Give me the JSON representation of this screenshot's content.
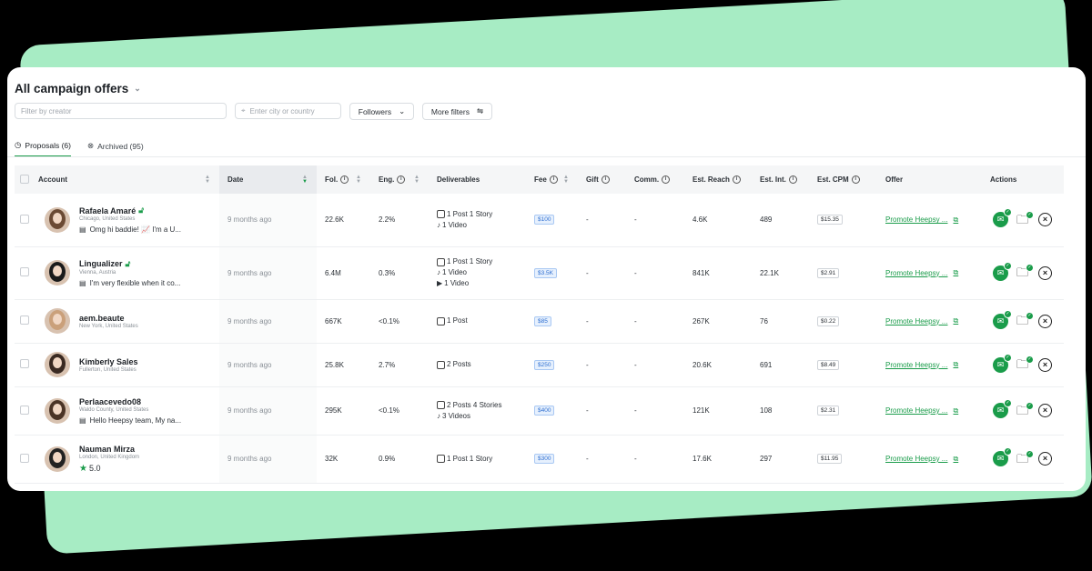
{
  "page": {
    "title": "All campaign offers",
    "filter_creator_placeholder": "Filter by creator",
    "filter_city_placeholder": "Enter city or country",
    "followers_label": "Followers",
    "more_filters_label": "More filters",
    "tabs": [
      {
        "label": "Proposals (6)"
      },
      {
        "label": "Archived (95)"
      }
    ]
  },
  "columns": {
    "account": "Account",
    "date": "Date",
    "fol": "Fol.",
    "eng": "Eng.",
    "deliverables": "Deliverables",
    "fee": "Fee",
    "gift": "Gift",
    "comm": "Comm.",
    "reach": "Est. Reach",
    "int": "Est. Int.",
    "cpm": "Est. CPM",
    "offer": "Offer",
    "actions": "Actions"
  },
  "rows": [
    {
      "name": "Rafaela Amaré",
      "location": "Chicago, United States",
      "message": "Omg hi baddie! 📈 I'm a U...",
      "date": "9 months ago",
      "fol": "22.6K",
      "eng": "2.2%",
      "d1": "1 Post  1 Story",
      "d2": "1 Video",
      "d3": "",
      "fee": "$100",
      "gift": "-",
      "comm": "-",
      "reach": "4.6K",
      "int": "489",
      "cpm": "$15.35",
      "offer": "Promote Heepsy ..."
    },
    {
      "name": "Lingualizer",
      "location": "Vienna, Austria",
      "message": "I'm very flexible when it co...",
      "date": "9 months ago",
      "fol": "6.4M",
      "eng": "0.3%",
      "d1": "1 Post  1 Story",
      "d2": "1 Video",
      "d3": "1 Video",
      "fee": "$3.5K",
      "gift": "-",
      "comm": "-",
      "reach": "841K",
      "int": "22.1K",
      "cpm": "$2.91",
      "offer": "Promote Heepsy ..."
    },
    {
      "name": "aem.beaute",
      "location": "New York, United States",
      "message": "",
      "date": "9 months ago",
      "fol": "667K",
      "eng": "<0.1%",
      "d1": "1 Post",
      "d2": "",
      "d3": "",
      "fee": "$85",
      "gift": "-",
      "comm": "-",
      "reach": "267K",
      "int": "76",
      "cpm": "$0.22",
      "offer": "Promote Heepsy ..."
    },
    {
      "name": "Kimberly Sales",
      "location": "Fullerton, United States",
      "message": "",
      "date": "9 months ago",
      "fol": "25.8K",
      "eng": "2.7%",
      "d1": "2 Posts",
      "d2": "",
      "d3": "",
      "fee": "$250",
      "gift": "-",
      "comm": "-",
      "reach": "20.6K",
      "int": "691",
      "cpm": "$8.49",
      "offer": "Promote Heepsy ..."
    },
    {
      "name": "Perlaacevedo08",
      "location": "Waldo County, United States",
      "message": "Hello Heepsy team, My na...",
      "date": "9 months ago",
      "fol": "295K",
      "eng": "<0.1%",
      "d1": "2 Posts  4 Stories",
      "d2": "3 Videos",
      "d3": "",
      "fee": "$400",
      "gift": "-",
      "comm": "-",
      "reach": "121K",
      "int": "108",
      "cpm": "$2.31",
      "offer": "Promote Heepsy ..."
    },
    {
      "name": "Nauman Mirza",
      "location": "London, United Kingdom",
      "message": "",
      "rating": "5.0",
      "date": "9 months ago",
      "fol": "32K",
      "eng": "0.9%",
      "d1": "1 Post  1 Story",
      "d2": "",
      "d3": "",
      "fee": "$300",
      "gift": "-",
      "comm": "-",
      "reach": "17.6K",
      "int": "297",
      "cpm": "$11.95",
      "offer": "Promote Heepsy ..."
    }
  ],
  "colors": {
    "accent": "#1a9c4a",
    "background_green": "#a7ecc4",
    "fee_blue": "#2f6fd1"
  }
}
